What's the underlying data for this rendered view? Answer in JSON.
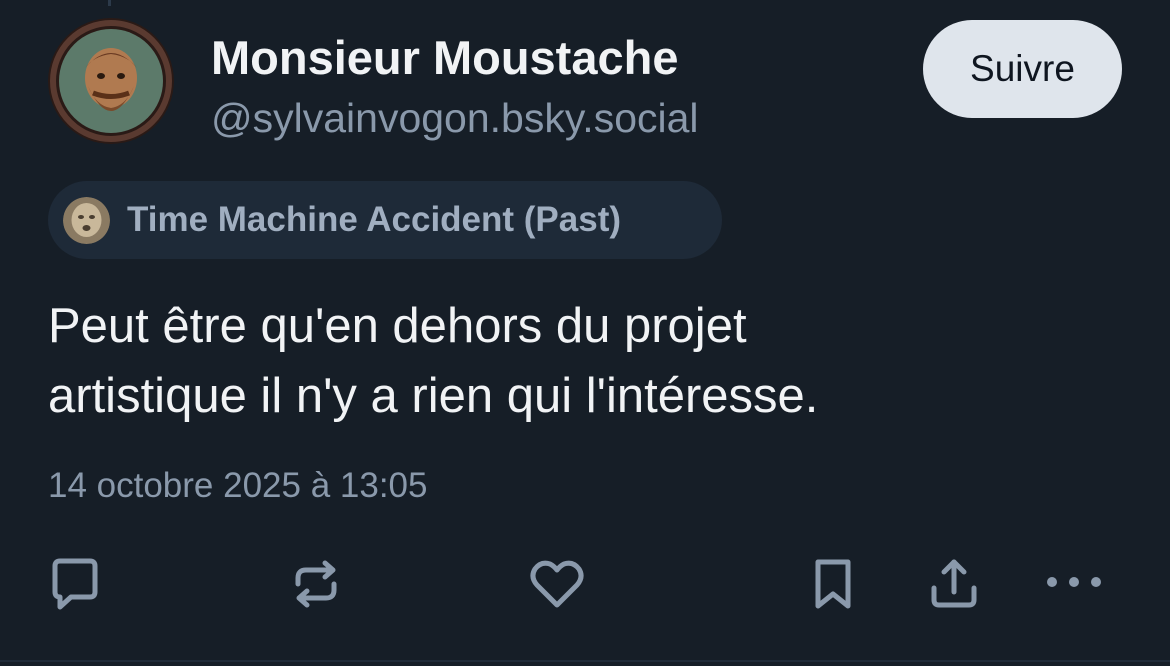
{
  "author": {
    "display_name": "Monsieur Moustache",
    "handle": "@sylvainvogon.bsky.social"
  },
  "follow_button": {
    "label": "Suivre"
  },
  "label": {
    "text": "Time Machine Accident (Past)"
  },
  "post": {
    "lines": [
      "Peut être qu'en dehors du projet",
      "artistique il n'y a rien qui l'intéresse."
    ],
    "timestamp": "14 octobre 2025 à 13:05"
  },
  "actions": [
    {
      "icon": "reply-icon"
    },
    {
      "icon": "repost-icon"
    },
    {
      "icon": "like-icon"
    },
    {
      "icon": "bookmark-icon"
    },
    {
      "icon": "share-icon"
    },
    {
      "icon": "more-icon"
    }
  ],
  "colors": {
    "background": "#161e27",
    "primary_text": "#f1f3f5",
    "secondary_text": "#8a99ab",
    "chip_background": "#1e2a38",
    "follow_button_bg": "#dfe5ec",
    "icon": "#8a99ab"
  }
}
